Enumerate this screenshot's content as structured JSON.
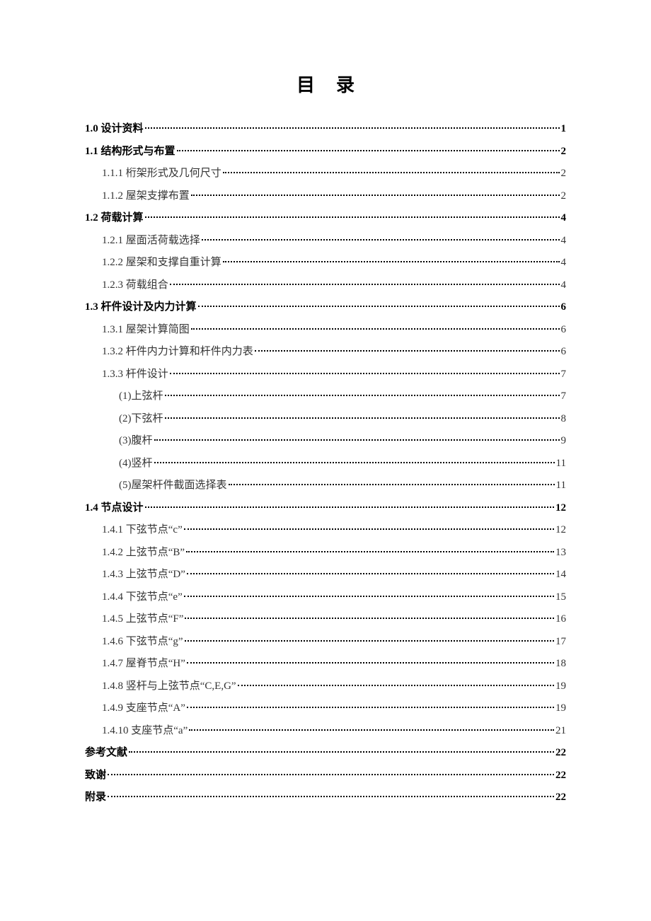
{
  "title": "目录",
  "entries": [
    {
      "level": 0,
      "label": "1.0 设计资料",
      "page": "1"
    },
    {
      "level": 0,
      "label": "1.1 结构形式与布置",
      "page": "2"
    },
    {
      "level": 1,
      "label": "1.1.1 桁架形式及几何尺寸",
      "page": "2"
    },
    {
      "level": 1,
      "label": "1.1.2 屋架支撑布置",
      "page": "2"
    },
    {
      "level": 0,
      "label": "1.2 荷载计算",
      "page": "4"
    },
    {
      "level": 1,
      "label": "1.2.1 屋面活荷载选择",
      "page": "4"
    },
    {
      "level": 1,
      "label": "1.2.2 屋架和支撑自重计算",
      "page": "4"
    },
    {
      "level": 1,
      "label": "1.2.3 荷载组合",
      "page": "4"
    },
    {
      "level": 0,
      "label": "1.3 杆件设计及内力计算",
      "page": "6"
    },
    {
      "level": 1,
      "label": "1.3.1 屋架计算简图",
      "page": "6"
    },
    {
      "level": 1,
      "label": "1.3.2 杆件内力计算和杆件内力表",
      "page": "6"
    },
    {
      "level": 1,
      "label": "1.3.3 杆件设计",
      "page": "7"
    },
    {
      "level": 2,
      "label": "(1)上弦杆",
      "page": "7"
    },
    {
      "level": 2,
      "label": "(2)下弦杆",
      "page": "8"
    },
    {
      "level": 2,
      "label": "(3)腹杆",
      "page": "9"
    },
    {
      "level": 2,
      "label": "(4)竖杆",
      "page": "11"
    },
    {
      "level": 2,
      "label": "(5)屋架杆件截面选择表",
      "page": "11"
    },
    {
      "level": 0,
      "label": "1.4 节点设计",
      "page": "12"
    },
    {
      "level": 1,
      "label": "1.4.1 下弦节点“c”",
      "page": "12"
    },
    {
      "level": 1,
      "label": "1.4.2 上弦节点“B”",
      "page": "13"
    },
    {
      "level": 1,
      "label": "1.4.3 上弦节点“D”",
      "page": "14"
    },
    {
      "level": 1,
      "label": "1.4.4 下弦节点“e”",
      "page": "15"
    },
    {
      "level": 1,
      "label": "1.4.5 上弦节点“F”",
      "page": "16"
    },
    {
      "level": 1,
      "label": "1.4.6 下弦节点“g”",
      "page": "17"
    },
    {
      "level": 1,
      "label": "1.4.7 屋脊节点“H”",
      "page": "18"
    },
    {
      "level": 1,
      "label": "1.4.8 竖杆与上弦节点“C,E,G”",
      "page": "19"
    },
    {
      "level": 1,
      "label": "1.4.9 支座节点“A”",
      "page": "19"
    },
    {
      "level": 1,
      "label": "1.4.10 支座节点“a”",
      "page": "21"
    },
    {
      "level": -1,
      "label": "参考文献",
      "page": "22"
    },
    {
      "level": -1,
      "label": "致谢",
      "page": "22"
    },
    {
      "level": -1,
      "label": "附录",
      "page": "22"
    }
  ]
}
